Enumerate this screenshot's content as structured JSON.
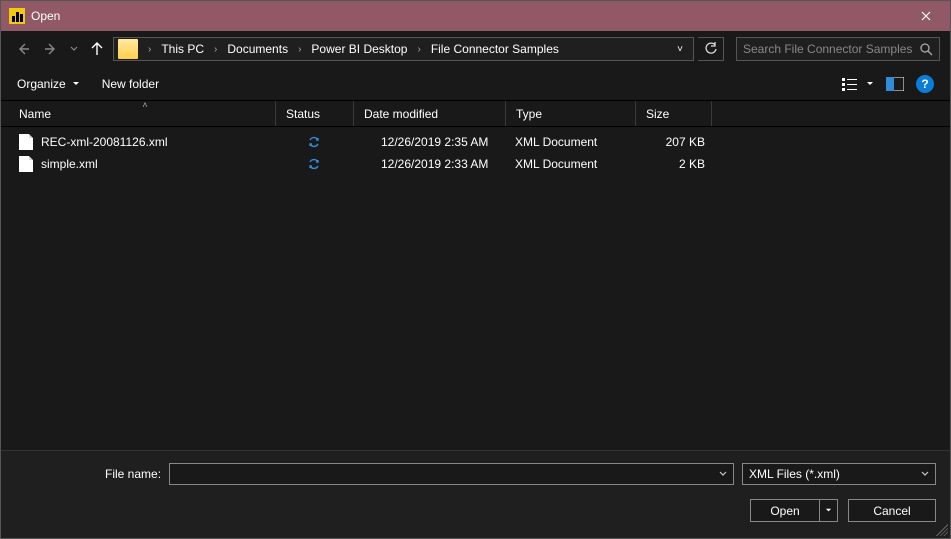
{
  "title": "Open",
  "breadcrumb": {
    "segments": [
      "This PC",
      "Documents",
      "Power BI Desktop",
      "File Connector Samples"
    ]
  },
  "search": {
    "placeholder": "Search File Connector Samples"
  },
  "toolbar": {
    "organize_label": "Organize",
    "newfolder_label": "New folder"
  },
  "columns": {
    "name": "Name",
    "status": "Status",
    "date": "Date modified",
    "type": "Type",
    "size": "Size"
  },
  "files": [
    {
      "name": "REC-xml-20081126.xml",
      "date": "12/26/2019 2:35 AM",
      "type": "XML Document",
      "size": "207 KB"
    },
    {
      "name": "simple.xml",
      "date": "12/26/2019 2:33 AM",
      "type": "XML Document",
      "size": "2 KB"
    }
  ],
  "bottom": {
    "filename_label": "File name:",
    "filename_value": "",
    "filetype_label": "XML Files (*.xml)",
    "open_label": "Open",
    "cancel_label": "Cancel"
  }
}
